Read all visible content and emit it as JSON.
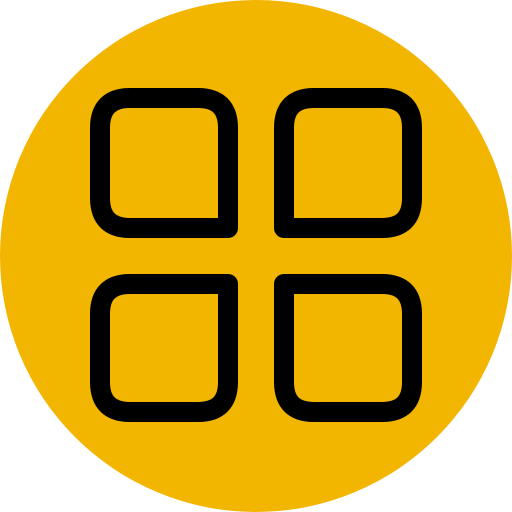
{
  "icon": {
    "name": "app-grid-icon",
    "background_color": "#F2B600",
    "stroke_color": "#000000"
  }
}
